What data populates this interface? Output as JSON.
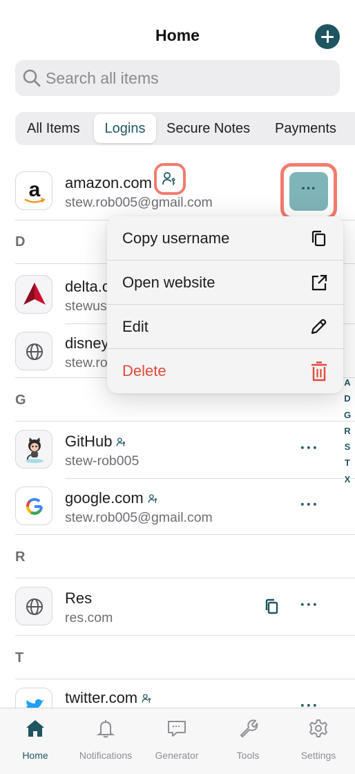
{
  "header": {
    "title": "Home",
    "add_icon": "plus-circle-icon"
  },
  "search": {
    "placeholder": "Search all items"
  },
  "tabs": [
    {
      "label": "All Items",
      "active": false
    },
    {
      "label": "Logins",
      "active": true
    },
    {
      "label": "Secure Notes",
      "active": false
    },
    {
      "label": "Payments",
      "active": false
    }
  ],
  "sections": {
    "d": "D",
    "g": "G",
    "r": "R",
    "t": "T"
  },
  "items": [
    {
      "name": "amazon.com",
      "user": "stew.rob005@gmail.com",
      "shared": true,
      "logo": "amazon-logo"
    },
    {
      "name": "delta.com",
      "user": "stewus",
      "logo": "delta-logo"
    },
    {
      "name": "disney",
      "user": "stew.ro",
      "logo": "globe-icon"
    },
    {
      "name": "GitHub",
      "user": "stew-rob005",
      "shared": true,
      "logo": "github-logo"
    },
    {
      "name": "google.com",
      "user": "stew.rob005@gmail.com",
      "shared": true,
      "logo": "google-logo"
    },
    {
      "name": "Res",
      "user": "res.com",
      "logo": "globe-icon"
    },
    {
      "name": "twitter.com",
      "user": "",
      "shared": true,
      "logo": "twitter-logo"
    }
  ],
  "menu": {
    "copy_username": "Copy username",
    "open_website": "Open website",
    "edit": "Edit",
    "delete": "Delete"
  },
  "index_letters": [
    "A",
    "D",
    "G",
    "R",
    "S",
    "T",
    "X"
  ],
  "tabbar": [
    {
      "label": "Home",
      "icon": "home-icon",
      "active": true
    },
    {
      "label": "Notifications",
      "icon": "bell-icon",
      "active": false
    },
    {
      "label": "Generator",
      "icon": "generator-icon",
      "active": false
    },
    {
      "label": "Tools",
      "icon": "wrench-icon",
      "active": false
    },
    {
      "label": "Settings",
      "icon": "gear-icon",
      "active": false
    }
  ],
  "colors": {
    "accent": "#1f5560",
    "danger": "#e1493a",
    "highlight": "#f27b6e"
  }
}
